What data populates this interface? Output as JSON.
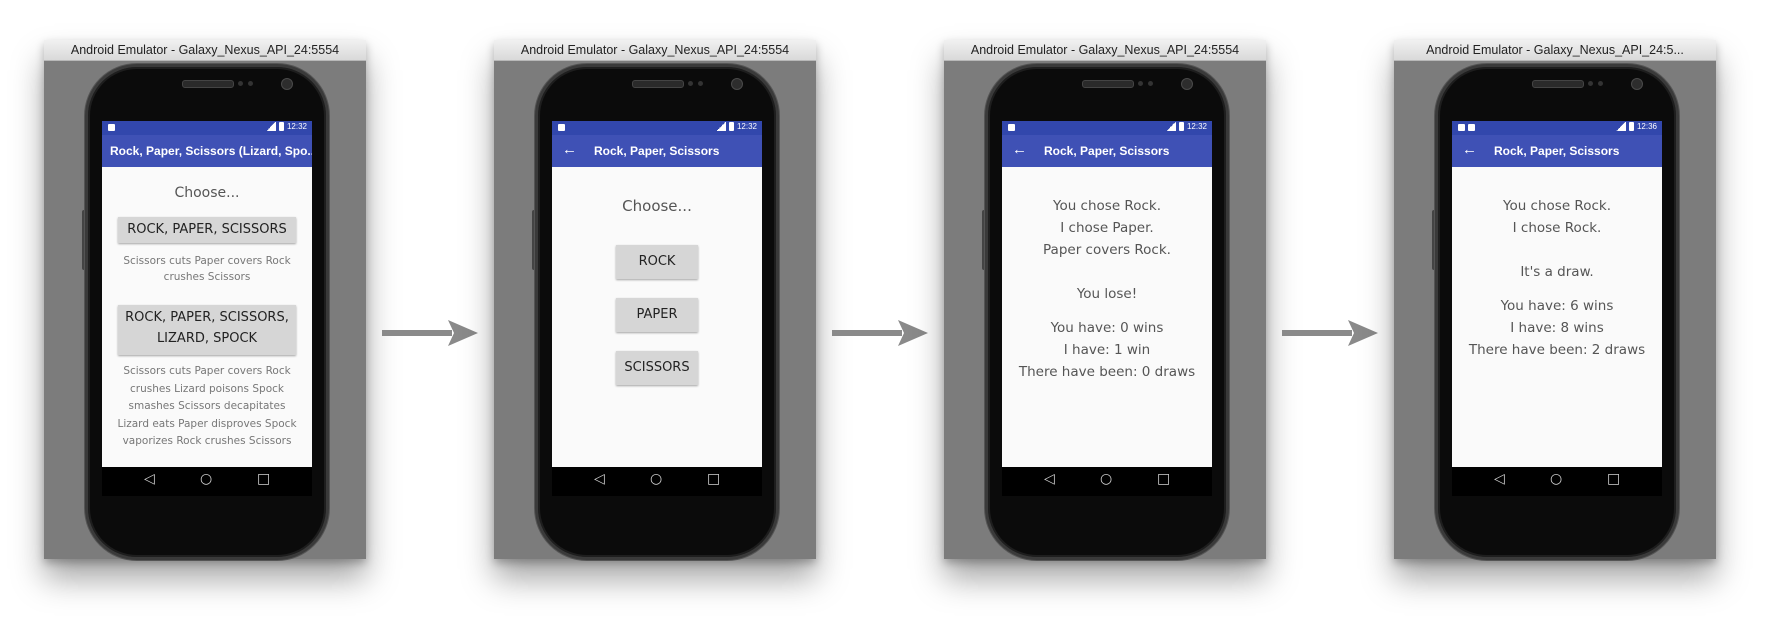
{
  "emulators": [
    {
      "window_title": "Android Emulator - Galaxy_Nexus_API_24:5554",
      "status_time": "12:32",
      "app_title": "Rock, Paper, Scissors (Lizard, Spo...",
      "choose_label": "Choose...",
      "rps_button": "ROCK, PAPER, SCISSORS",
      "rps_desc": "Scissors cuts Paper covers Rock crushes Scissors",
      "rpsls_button": "ROCK, PAPER, SCISSORS, LIZARD, SPOCK",
      "rpsls_desc": "Scissors cuts Paper covers Rock crushes Lizard poisons Spock smashes Scissors decapitates Lizard eats Paper disproves Spock vaporizes Rock crushes Scissors"
    },
    {
      "window_title": "Android Emulator - Galaxy_Nexus_API_24:5554",
      "status_time": "12:32",
      "app_title": "Rock, Paper, Scissors",
      "choose_label": "Choose...",
      "rock_button": "ROCK",
      "paper_button": "PAPER",
      "scissors_button": "SCISSORS"
    },
    {
      "window_title": "Android Emulator - Galaxy_Nexus_API_24:5554",
      "status_time": "12:32",
      "app_title": "Rock, Paper, Scissors",
      "user_choice": "You chose Rock.",
      "cpu_choice": "I chose Paper.",
      "rule": "Paper covers Rock.",
      "outcome": "You lose!",
      "user_wins": "You have: 0 wins",
      "cpu_wins": "I have: 1 win",
      "draws": "There have been: 0 draws"
    },
    {
      "window_title": "Android Emulator - Galaxy_Nexus_API_24:5...",
      "status_time": "12:36",
      "app_title": "Rock, Paper, Scissors",
      "user_choice": "You chose Rock.",
      "cpu_choice": "I chose Rock.",
      "outcome": "It's a draw.",
      "user_wins": "You have: 6 wins",
      "cpu_wins": "I have: 8 wins",
      "draws": "There have been: 2 draws"
    }
  ],
  "icons": {
    "back": "arrow-back-icon",
    "nav_back": "nav-back-icon",
    "nav_home": "nav-home-icon",
    "nav_recents": "nav-recents-icon",
    "flow_arrow": "flow-arrow-icon"
  },
  "colors": {
    "app_bar": "#3f51b5",
    "status_bar": "#3247ac",
    "emulator_frame": "#7c7c7c",
    "arrow": "#8a8a8a"
  }
}
